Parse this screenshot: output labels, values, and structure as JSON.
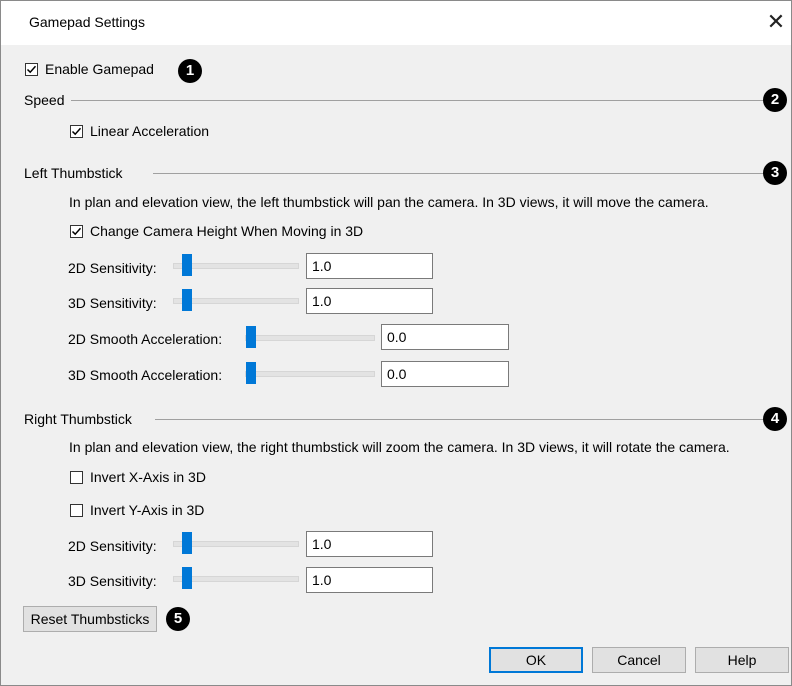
{
  "window": {
    "title": "Gamepad Settings",
    "close_glyph": "✕"
  },
  "enable": {
    "label": "Enable Gamepad",
    "checked": true,
    "badge": "1"
  },
  "speed": {
    "heading": "Speed",
    "badge": "2",
    "linear_label": "Linear Acceleration",
    "linear_checked": true
  },
  "left": {
    "heading": "Left Thumbstick",
    "badge": "3",
    "description": "In plan and elevation view, the left thumbstick will pan the camera. In 3D views, it will move the camera.",
    "height_label": "Change Camera Height When Moving in 3D",
    "height_checked": true,
    "sens2d_label": "2D Sensitivity:",
    "sens2d_value": "1.0",
    "sens3d_label": "3D Sensitivity:",
    "sens3d_value": "1.0",
    "smooth2d_label": "2D Smooth Acceleration:",
    "smooth2d_value": "0.0",
    "smooth3d_label": "3D Smooth Acceleration:",
    "smooth3d_value": "0.0"
  },
  "right": {
    "heading": "Right Thumbstick",
    "badge": "4",
    "description": "In plan and elevation view, the right thumbstick will zoom the camera. In 3D views, it will rotate the camera.",
    "invertx_label": "Invert X-Axis in 3D",
    "invertx_checked": false,
    "inverty_label": "Invert Y-Axis in 3D",
    "inverty_checked": false,
    "sens2d_label": "2D Sensitivity:",
    "sens2d_value": "1.0",
    "sens3d_label": "3D Sensitivity:",
    "sens3d_value": "1.0"
  },
  "reset": {
    "label": "Reset Thumbsticks",
    "badge": "5"
  },
  "footer": {
    "ok_label": "OK",
    "cancel_label": "Cancel",
    "help_label": "Help"
  },
  "colors": {
    "accent": "#0078d7",
    "badge": "#000000"
  },
  "icons": {
    "check": "check-icon",
    "close": "close-icon"
  }
}
